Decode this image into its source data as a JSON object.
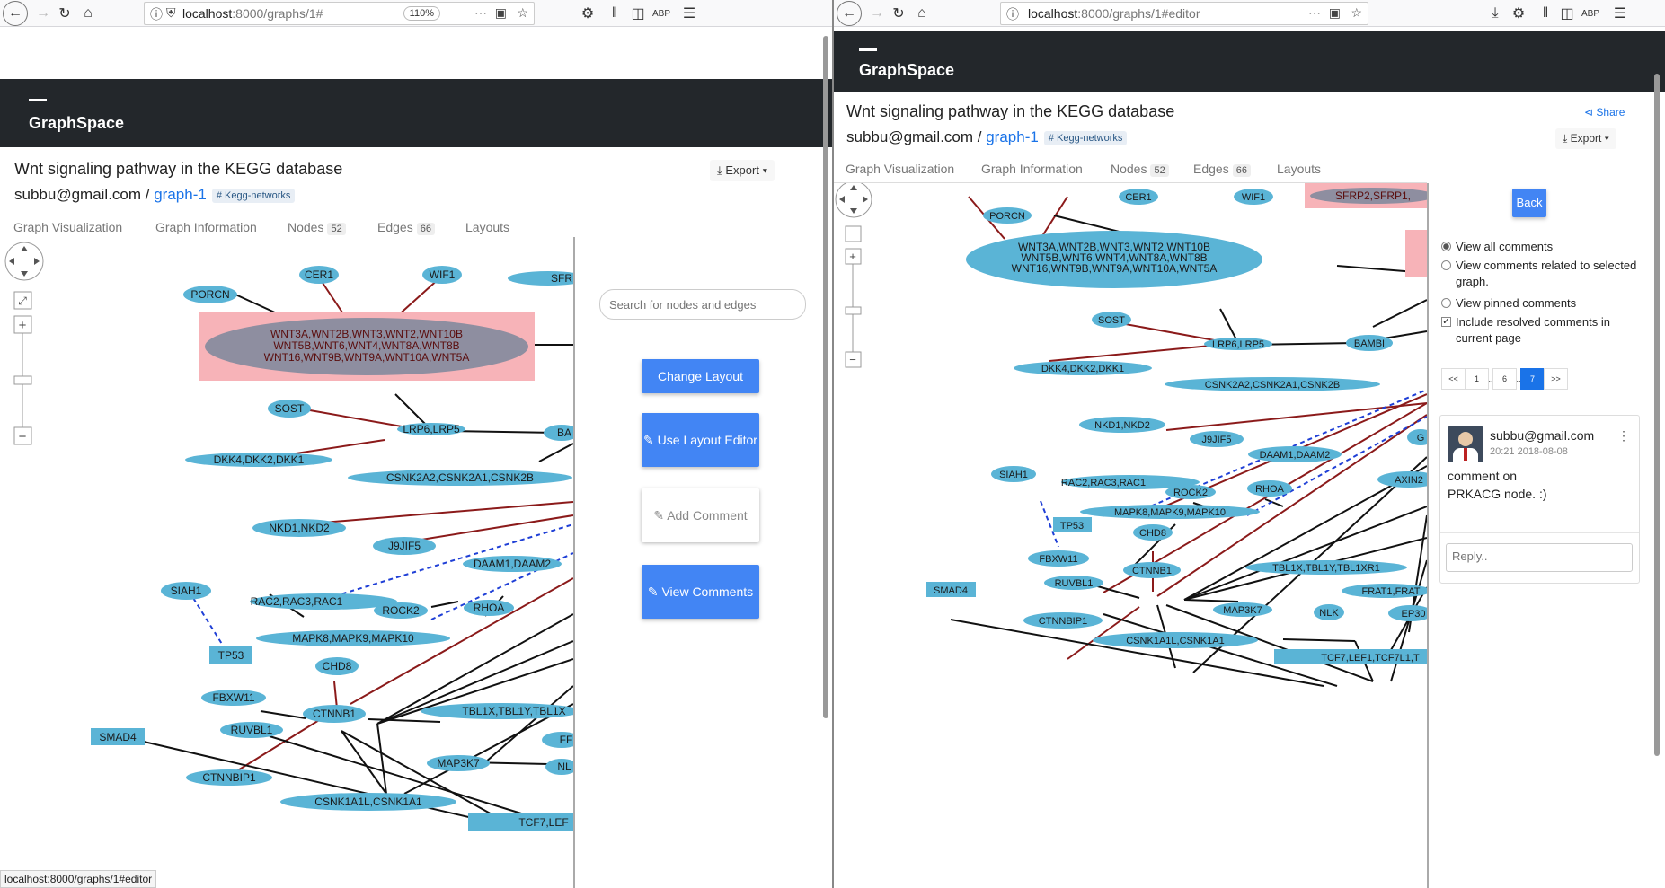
{
  "left": {
    "url_host": "localhost",
    "url_path": ":8000/graphs/1#",
    "zoom": "110%",
    "brand": "GraphSpace",
    "graph_title": "Wnt signaling pathway in the KEGG database",
    "owner": "subbu@gmail.com",
    "separator": " / ",
    "graph_name": "graph-1",
    "tag": "# Kegg-networks",
    "export_label": "Export",
    "tabs": {
      "visualization": "Graph Visualization",
      "information": "Graph Information",
      "nodes": "Nodes",
      "nodes_count": "52",
      "edges": "Edges",
      "edges_count": "66",
      "layouts": "Layouts"
    },
    "search_placeholder": "Search for nodes and edges",
    "buttons": {
      "change_layout": "Change Layout",
      "use_layout_editor": "Use Layout Editor",
      "add_comment": "Add Comment",
      "view_comments": "View Comments"
    },
    "status_url": "localhost:8000/graphs/1#editor"
  },
  "right": {
    "url_host": "localhost",
    "url_path": ":8000/graphs/1#editor",
    "brand": "GraphSpace",
    "graph_title": "Wnt signaling pathway in the KEGG database",
    "owner": "subbu@gmail.com",
    "separator": " / ",
    "graph_name": "graph-1",
    "tag": "# Kegg-networks",
    "share_label": "Share",
    "export_label": "Export",
    "tabs": {
      "visualization": "Graph Visualization",
      "information": "Graph Information",
      "nodes": "Nodes",
      "nodes_count": "52",
      "edges": "Edges",
      "edges_count": "66",
      "layouts": "Layouts"
    },
    "back_label": "Back",
    "filters": {
      "all": "View all comments",
      "related": "View comments related to selected graph.",
      "pinned": "View pinned comments",
      "resolved": "Include resolved comments in current page"
    },
    "pager": [
      "<<",
      "1",
      "..",
      "6",
      "..",
      "7",
      ">>"
    ],
    "comment": {
      "author": "subbu@gmail.com",
      "time": "20:21 2018-08-08",
      "text": "comment on PRKACG node. :)",
      "reply_placeholder": "Reply.."
    }
  },
  "graph_labels": {
    "wnt_cluster_1": "WNT3A,WNT2B,WNT3,WNT2,WNT10B",
    "wnt_cluster_2": "WNT5B,WNT6,WNT4,WNT8A,WNT8B",
    "wnt_cluster_3": "WNT16,WNT9B,WNT9A,WNT10A,WNT5A",
    "porcn": "PORCN",
    "cer1": "CER1",
    "wif1": "WIF1",
    "sfrp": "SFR",
    "sfrp_full": "SFRP2,SFRP1,",
    "sost": "SOST",
    "lrp": "LRP6,LRP5",
    "dkk": "DKK4,DKK2,DKK1",
    "csnk2": "CSNK2A2,CSNK2A1,CSNK2B",
    "nkd": "NKD1,NKD2",
    "j9jif5": "J9JIF5",
    "daam": "DAAM1,DAAM2",
    "siah1": "SIAH1",
    "rac": "RAC2,RAC3,RAC1",
    "rock2": "ROCK2",
    "rhoa": "RHOA",
    "tp53": "TP53",
    "mapk": "MAPK8,MAPK9,MAPK10",
    "chd8": "CHD8",
    "fbxw11": "FBXW11",
    "ctnnb1": "CTNNB1",
    "tbl_left": "TBL1X,TBL1Y,TBL1X",
    "tbl_right": "TBL1X,TBL1Y,TBL1XR1",
    "ruvbl1": "RUVBL1",
    "smad4": "SMAD4",
    "map3k7": "MAP3K7",
    "nl": "NL",
    "nlk": "NLK",
    "ctnnbip1": "CTNNBIP1",
    "csnk1": "CSNK1A1L,CSNK1A1",
    "tcf_left": "TCF7,LEF",
    "tcf_right": "TCF7,LEF1,TCF7L1,T",
    "ba": "BA",
    "bambi": "BAMBI",
    "ff": "FF",
    "frat": "FRAT1,FRAT",
    "ep30": "EP30",
    "axin": "AXIN2",
    "g": "G"
  },
  "colors": {
    "node_fill": "#5ab4d6",
    "highlight_fill": "#f7b3b8",
    "inhibit_edge": "#8b1a1a",
    "dashed_edge": "#1f3fd6",
    "primary_button": "#4285f4",
    "navbar": "#23272b",
    "link": "#1a73e8"
  }
}
